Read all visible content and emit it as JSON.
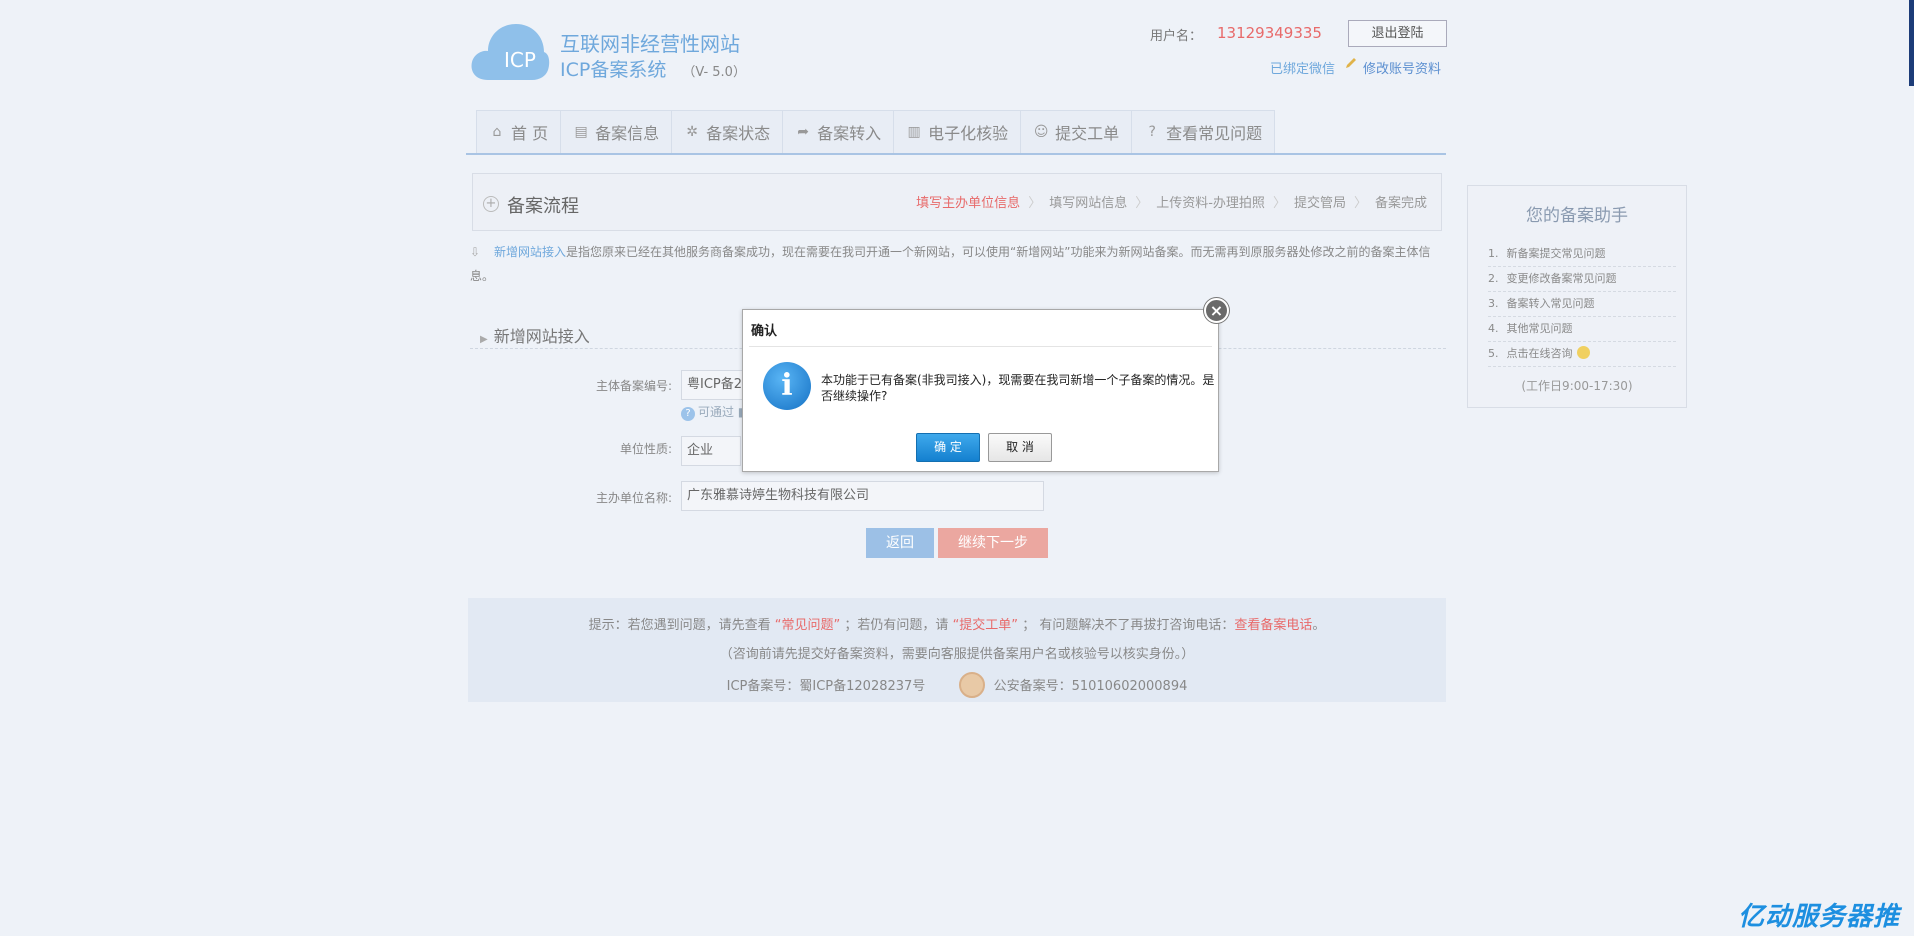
{
  "header": {
    "logo_text": "ICP",
    "title": "互联网非经营性网站",
    "subtitle": "ICP备案系统",
    "version": "（V- 5.0）",
    "user_label": "用户名：",
    "user_value": "13129349335",
    "logout_label": "退出登陆",
    "wx_bound": "已绑定微信",
    "edit_account": "修改账号资料"
  },
  "nav": {
    "items": [
      {
        "label": "首 页",
        "icon": "home-icon"
      },
      {
        "label": "备案信息",
        "icon": "document-icon"
      },
      {
        "label": "备案状态",
        "icon": "gear-icon"
      },
      {
        "label": "备案转入",
        "icon": "share-arrow-icon"
      },
      {
        "label": "电子化核验",
        "icon": "clipboard-icon"
      },
      {
        "label": "提交工单",
        "icon": "user-icon"
      },
      {
        "label": "查看常见问题",
        "icon": "question-icon"
      }
    ]
  },
  "process": {
    "title": "备案流程",
    "steps": [
      "填写主办单位信息",
      "填写网站信息",
      "上传资料-办理拍照",
      "提交管局",
      "备案完成"
    ]
  },
  "notice": {
    "link": "新增网站接入",
    "text": "是指您原来已经在其他服务商备案成功，现在需要在我司开通一个新网站，可以使用“新增网站”功能来为新网站备案。而无需再到原服务器处修改之前的备案主体信息。"
  },
  "section": {
    "title": "新增网站接入"
  },
  "form": {
    "record_no_label": "主体备案编号:",
    "record_no_value": "粤ICP备2",
    "hint": "可通过 ■",
    "unit_type_label": "单位性质:",
    "unit_type_value": "企业",
    "unit_name_label": "主办单位名称:",
    "unit_name_value": "广东雅慕诗婷生物科技有限公司",
    "back_label": "返回",
    "next_label": "继续下一步"
  },
  "helper": {
    "title": "您的备案助手",
    "items": [
      {
        "n": "1.",
        "label": "新备案提交常见问题"
      },
      {
        "n": "2.",
        "label": "变更修改备案常见问题"
      },
      {
        "n": "3.",
        "label": "备案转入常见问题"
      },
      {
        "n": "4.",
        "label": "其他常见问题"
      },
      {
        "n": "5.",
        "label": "点击在线咨询"
      }
    ],
    "hours": "(工作日9:00-17:30)"
  },
  "footer": {
    "tip_prefix": "提示：若您遇到问题，请先查看",
    "faq": "“常见问题”",
    "tip_mid1": "；若仍有问题，请",
    "ticket": "“提交工单”",
    "tip_mid2": "；  有问题解决不了再拔打咨询电话：",
    "phone": "查看备案电话",
    "tip_end": "。",
    "note": "（咨询前请先提交好备案资料，需要向客服提供备案用户名或核验号以核实身份。）",
    "icp_no": "ICP备案号：蜀ICP备12028237号",
    "police_no": "公安备案号：51010602000894"
  },
  "dialog": {
    "title": "确认",
    "message": "本功能于已有备案(非我司接入)，现需要在我司新增一个子备案的情况。是否继续操作?",
    "ok_label": "确 定",
    "cancel_label": "取 消"
  },
  "watermark": "亿动服务器推",
  "colors": {
    "accent_blue": "#6fa8dc",
    "accent_red": "#e86a6a",
    "ok_button": "#1480cf"
  }
}
